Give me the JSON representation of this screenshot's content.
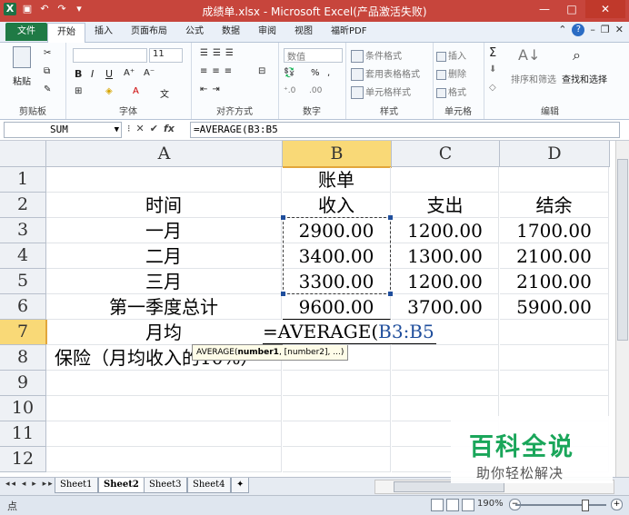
{
  "window": {
    "title": "成绩单.xlsx - Microsoft Excel(产品激活失败)"
  },
  "ribbon_tabs": [
    "文件",
    "开始",
    "插入",
    "页面布局",
    "公式",
    "数据",
    "审阅",
    "视图",
    "福昕PDF"
  ],
  "ribbon": {
    "clipboard": {
      "paste": "粘贴",
      "label": "剪贴板"
    },
    "font": {
      "size": "11",
      "bold": "B",
      "italic": "I",
      "underline": "U",
      "label": "字体"
    },
    "alignment": {
      "label": "对齐方式"
    },
    "number": {
      "format": "数值",
      "percent": "%",
      "comma": ",",
      "label": "数字"
    },
    "styles": {
      "conditional": "条件格式",
      "table": "套用表格格式",
      "cell": "单元格样式",
      "label": "样式"
    },
    "cells": {
      "insert": "插入",
      "delete": "删除",
      "format": "格式",
      "label": "单元格"
    },
    "editing": {
      "sort": "排序和筛选",
      "find": "查找和选择",
      "sigma": "Σ",
      "label": "编辑"
    }
  },
  "formula_bar": {
    "name_box": "SUM",
    "fx": "fx",
    "formula": "=AVERAGE(B3:B5"
  },
  "columns": [
    "A",
    "B",
    "C",
    "D"
  ],
  "rows": [
    "1",
    "2",
    "3",
    "4",
    "5",
    "6",
    "7",
    "8",
    "9",
    "10",
    "11",
    "12"
  ],
  "cells": {
    "B1": "账单",
    "A2": "时间",
    "B2": "收入",
    "C2": "支出",
    "D2": "结余",
    "A3": "一月",
    "B3": "2900.00",
    "C3": "1200.00",
    "D3": "1700.00",
    "A4": "二月",
    "B4": "3400.00",
    "C4": "1300.00",
    "D4": "2100.00",
    "A5": "三月",
    "B5": "3300.00",
    "C5": "1200.00",
    "D5": "2100.00",
    "A6": "第一季度总计",
    "B6": "9600.00",
    "C6": "3700.00",
    "D6": "5900.00",
    "A7": "月均",
    "B7_edit_prefix": "=AVERAGE(",
    "B7_edit_ref": "B3:B5",
    "A8": "保险（月均收入的10%）"
  },
  "tooltip": {
    "fn": "AVERAGE(",
    "arg1": "number1",
    "rest": ", [number2], ...)"
  },
  "sheets": [
    "Sheet1",
    "Sheet2",
    "Sheet3",
    "Sheet4"
  ],
  "status": {
    "mode": "点",
    "zoom": "190%"
  },
  "watermark": {
    "line1": "百科全说",
    "line2": "助你轻松解决"
  },
  "colors": {
    "title_bar": "#c7453c",
    "file_tab": "#1f7a45",
    "selected_header": "#f9d977",
    "ref_blue": "#1f4e9c",
    "watermark_green": "#1aa65a"
  }
}
